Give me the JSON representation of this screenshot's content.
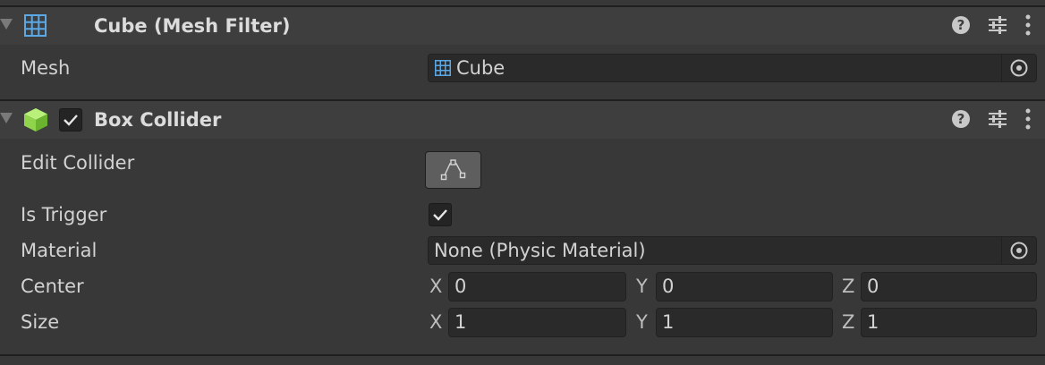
{
  "mesh_filter": {
    "title": "Cube (Mesh Filter)",
    "mesh_label": "Mesh",
    "mesh_value": "Cube"
  },
  "box_collider": {
    "title": "Box Collider",
    "enabled": true,
    "edit_collider_label": "Edit Collider",
    "is_trigger_label": "Is Trigger",
    "is_trigger": true,
    "material_label": "Material",
    "material_value": "None (Physic Material)",
    "center_label": "Center",
    "center": {
      "x": "0",
      "y": "0",
      "z": "0"
    },
    "size_label": "Size",
    "size": {
      "x": "1",
      "y": "1",
      "z": "1"
    }
  },
  "axis": {
    "x": "X",
    "y": "Y",
    "z": "Z"
  },
  "header_icons": {
    "help": "?"
  }
}
